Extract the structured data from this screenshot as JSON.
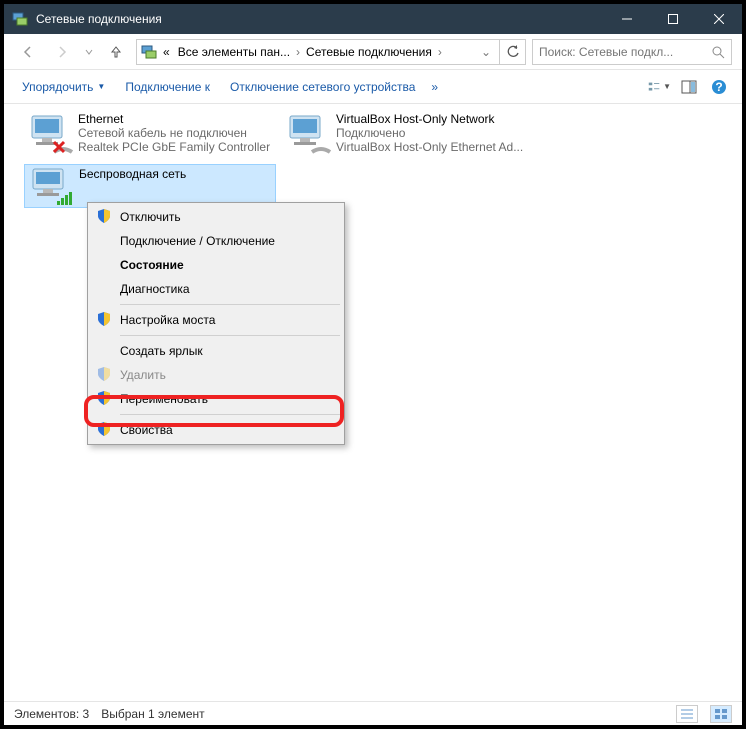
{
  "window": {
    "title": "Сетевые подключения"
  },
  "breadcrumbs": {
    "prefix": "«",
    "c1": "Все элементы пан...",
    "c2": "Сетевые подключения"
  },
  "search": {
    "placeholder": "Поиск: Сетевые подкл..."
  },
  "commandbar": {
    "organize": "Упорядочить",
    "connect": "Подключение к",
    "disable": "Отключение сетевого устройства",
    "overflow": "»"
  },
  "adapters": [
    {
      "name": "Ethernet",
      "status": "Сетевой кабель не подключен",
      "device": "Realtek PCIe GbE Family Controller",
      "state": "disconnected"
    },
    {
      "name": "VirtualBox Host-Only Network",
      "status": "Подключено",
      "device": "VirtualBox Host-Only Ethernet Ad...",
      "state": "connected"
    },
    {
      "name": "Беспроводная сеть",
      "status": "",
      "device": "",
      "state": "wifi-selected"
    }
  ],
  "context_menu": [
    {
      "label": "Отключить",
      "shield": true
    },
    {
      "label": "Подключение / Отключение",
      "shield": false
    },
    {
      "label": "Состояние",
      "shield": false,
      "bold": true
    },
    {
      "label": "Диагностика",
      "shield": false
    },
    {
      "sep": true
    },
    {
      "label": "Настройка моста",
      "shield": true
    },
    {
      "sep": true
    },
    {
      "label": "Создать ярлык",
      "shield": false
    },
    {
      "label": "Удалить",
      "shield": true,
      "disabled": true
    },
    {
      "label": "Переименовать",
      "shield": true
    },
    {
      "sep": true
    },
    {
      "label": "Свойства",
      "shield": true
    }
  ],
  "statusbar": {
    "count": "Элементов: 3",
    "selected": "Выбран 1 элемент"
  }
}
